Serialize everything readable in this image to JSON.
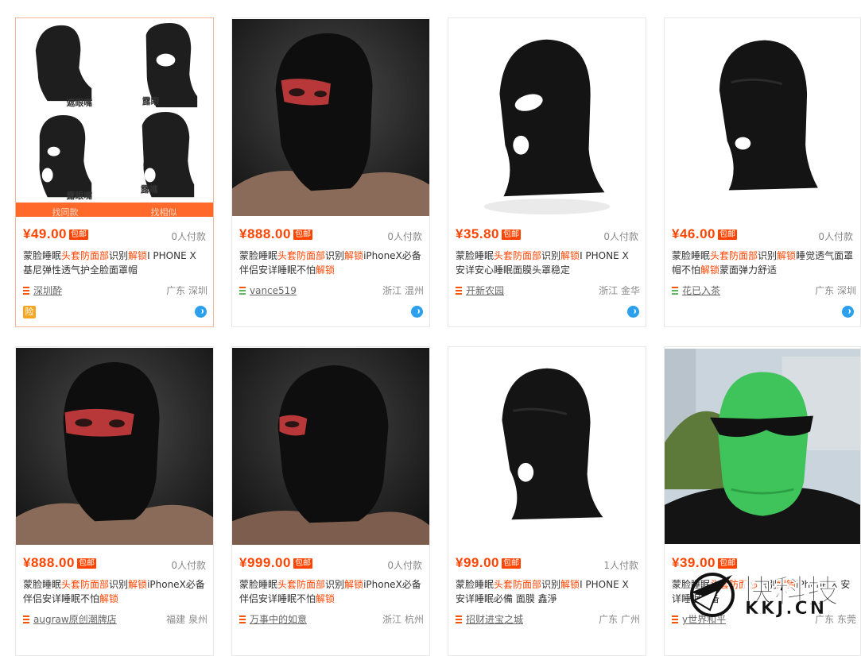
{
  "products": [
    {
      "price": "¥49.00",
      "badge": "包邮",
      "sales": "0人付款",
      "title_parts": [
        {
          "t": "蒙脸睡眠",
          "hl": false
        },
        {
          "t": "头套防面部",
          "hl": true
        },
        {
          "t": "识别",
          "hl": false
        },
        {
          "t": "解锁",
          "hl": true
        },
        {
          "t": "I PHONE X 基尼弹性透气护全脸面罩帽",
          "hl": false
        }
      ],
      "shop": "深圳酔",
      "location": "广东 深圳",
      "img_labels": [
        "遮眼嘴",
        "露眼",
        "露眼嘴",
        "露嘴"
      ],
      "actions": [
        "找同款",
        "找相似"
      ],
      "insurance": "险"
    },
    {
      "price": "¥888.00",
      "badge": "包邮",
      "sales": "0人付款",
      "title_parts": [
        {
          "t": "蒙脸睡眠",
          "hl": false
        },
        {
          "t": "头套防面部",
          "hl": true
        },
        {
          "t": "识别",
          "hl": false
        },
        {
          "t": "解锁",
          "hl": true
        },
        {
          "t": "iPhoneX必备伴侣安详睡眠不怕",
          "hl": false
        },
        {
          "t": "解锁",
          "hl": true
        }
      ],
      "shop": "vance519",
      "location": "浙江 温州"
    },
    {
      "price": "¥35.80",
      "badge": "包邮",
      "sales": "0人付款",
      "title_parts": [
        {
          "t": "蒙脸睡眠",
          "hl": false
        },
        {
          "t": "头套防面部",
          "hl": true
        },
        {
          "t": "识别",
          "hl": false
        },
        {
          "t": "解锁",
          "hl": true
        },
        {
          "t": "I PHONE X 安详安心睡眠面膜头罩稳定",
          "hl": false
        }
      ],
      "shop": "开新农园",
      "location": "浙江 金华"
    },
    {
      "price": "¥46.00",
      "badge": "包邮",
      "sales": "0人付款",
      "title_parts": [
        {
          "t": "蒙脸睡眠",
          "hl": false
        },
        {
          "t": "头套防面部",
          "hl": true
        },
        {
          "t": "识别",
          "hl": false
        },
        {
          "t": "解锁",
          "hl": true
        },
        {
          "t": "睡觉透气面罩帽不怕",
          "hl": false
        },
        {
          "t": "解锁",
          "hl": true
        },
        {
          "t": "蒙面弹力舒适",
          "hl": false
        }
      ],
      "shop": "花已入茶",
      "location": "广东 深圳"
    },
    {
      "price": "¥888.00",
      "badge": "包邮",
      "sales": "0人付款",
      "title_parts": [
        {
          "t": "蒙脸睡眠",
          "hl": false
        },
        {
          "t": "头套防面部",
          "hl": true
        },
        {
          "t": "识别",
          "hl": false
        },
        {
          "t": "解锁",
          "hl": true
        },
        {
          "t": "iPhoneX必备伴侣安详睡眠不怕",
          "hl": false
        },
        {
          "t": "解锁",
          "hl": true
        }
      ],
      "shop": "augraw原创潮牌店",
      "location": "福建 泉州"
    },
    {
      "price": "¥999.00",
      "badge": "包邮",
      "sales": "0人付款",
      "title_parts": [
        {
          "t": "蒙脸睡眠",
          "hl": false
        },
        {
          "t": "头套防面部",
          "hl": true
        },
        {
          "t": "识别",
          "hl": false
        },
        {
          "t": "解锁",
          "hl": true
        },
        {
          "t": "iPhoneX必备伴侣安详睡眠不怕",
          "hl": false
        },
        {
          "t": "解锁",
          "hl": true
        }
      ],
      "shop": "万事中的如意",
      "location": "浙江 杭州"
    },
    {
      "price": "¥99.00",
      "badge": "包邮",
      "sales": "1人付款",
      "title_parts": [
        {
          "t": "蒙脸睡眠",
          "hl": false
        },
        {
          "t": "头套防面部",
          "hl": true
        },
        {
          "t": "识别",
          "hl": false
        },
        {
          "t": "解锁",
          "hl": true
        },
        {
          "t": "I PHONE X 安详睡眠必備 面膜 鑫淨",
          "hl": false
        }
      ],
      "shop": "招财进宝之城",
      "location": "广东 广州"
    },
    {
      "price": "¥39.00",
      "badge": "包邮",
      "sales": "",
      "title_parts": [
        {
          "t": "蒙脸睡眠",
          "hl": false
        },
        {
          "t": "头套防面部",
          "hl": true
        },
        {
          "t": "识别",
          "hl": false
        },
        {
          "t": "解锁",
          "hl": true
        },
        {
          "t": "iPhone X 安详睡眠必备",
          "hl": false
        }
      ],
      "shop": "y世界和平",
      "location": "广东 东莞"
    }
  ],
  "watermark": {
    "cn": "快科技",
    "en": "KKJ.CN"
  },
  "colors": {
    "price": "#ff4400",
    "badge_bg": "#ff4400",
    "link": "#666666",
    "action_bar": "#ff6a2b"
  }
}
